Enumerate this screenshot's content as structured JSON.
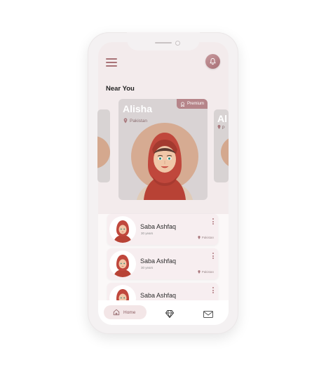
{
  "header": {
    "menu_icon": "hamburger-menu-icon",
    "notification_icon": "bell-icon"
  },
  "near_you": {
    "title": "Near You",
    "featured": {
      "name": "Alisha",
      "location": "Pakistan",
      "badge": "Premium"
    },
    "next_card": {
      "name": "Al",
      "location": "P"
    }
  },
  "list": [
    {
      "name": "Saba Ashfaq",
      "age": "30 years",
      "location": "Pakistan"
    },
    {
      "name": "Saba Ashfaq",
      "age": "30 years",
      "location": "Pakistan"
    },
    {
      "name": "Saba Ashfaq",
      "age": "",
      "location": ""
    }
  ],
  "bottom_nav": {
    "home_label": "Home",
    "active": "Home"
  },
  "colors": {
    "accent": "#b6858a",
    "hijab": "#c0473c",
    "screen_bg": "#f3ebec"
  }
}
